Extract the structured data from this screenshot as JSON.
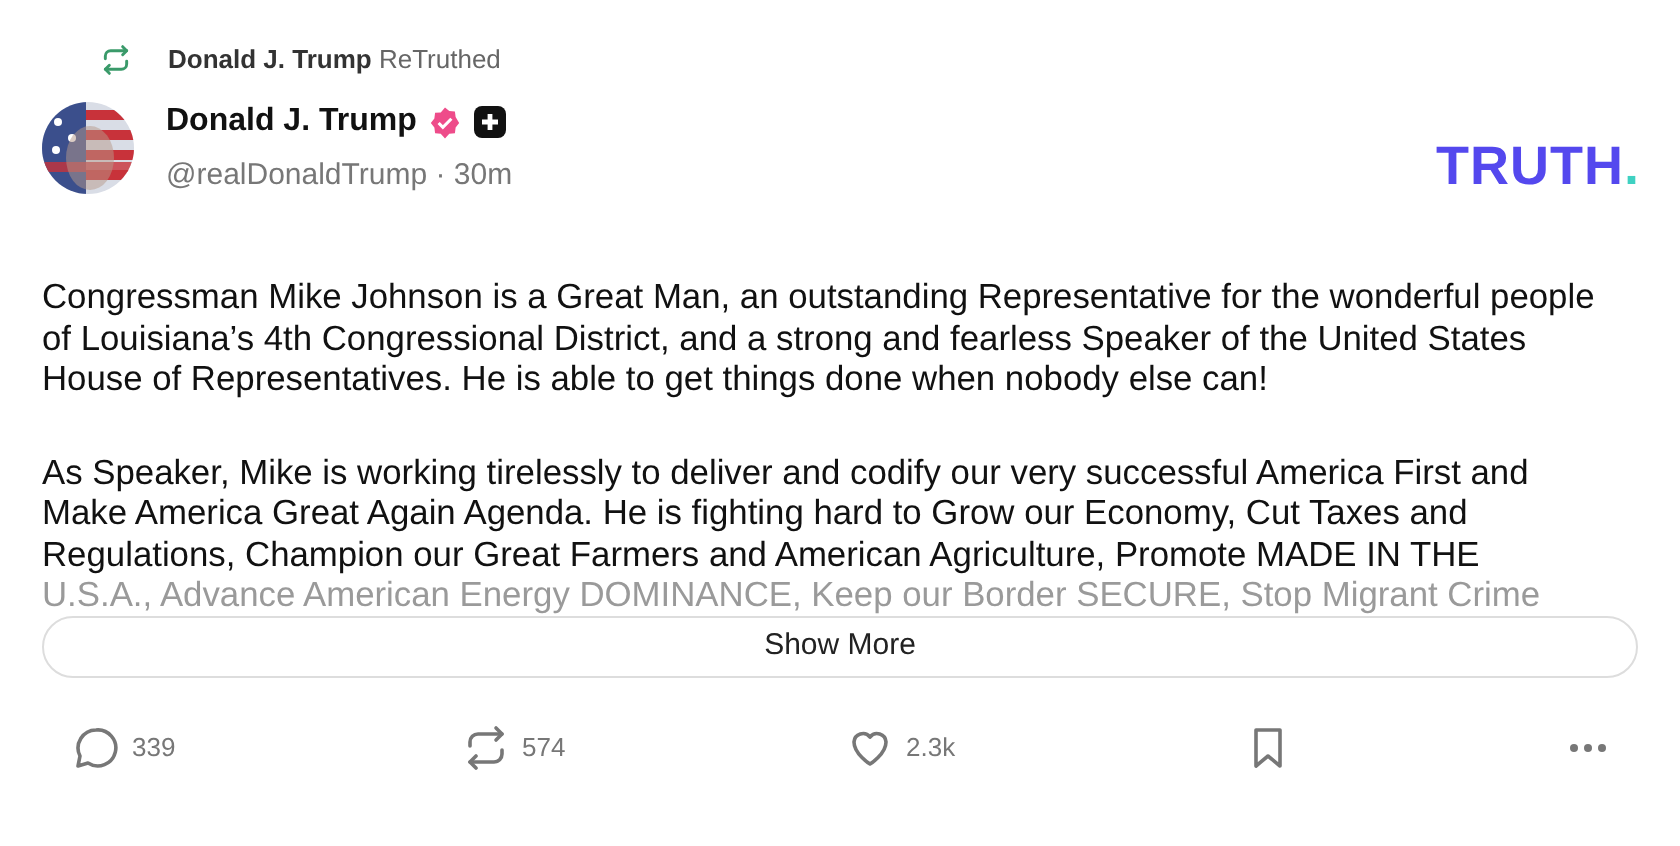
{
  "retruth": {
    "user": "Donald J. Trump",
    "label": "ReTruthed"
  },
  "author": {
    "name": "Donald J. Trump",
    "verified": true,
    "handle": "@realDonaldTrump",
    "separator": "·",
    "time": "30m"
  },
  "logo": {
    "text": "TRUTH",
    "mark": "."
  },
  "body": {
    "paragraphs": [
      "Congressman Mike Johnson is a Great Man, an outstanding Representative for the wonderful people of Louisiana’s 4th Congressional District, and a strong and fearless Speaker of the United States House of Representatives. He is able to get things done when nobody else can!",
      "As Speaker, Mike is working tirelessly to deliver and codify our very successful America First and Make America Great Again Agenda. He is fighting hard to Grow our Economy, Cut Taxes and Regulations, Champion our Great Farmers and American Agriculture, Promote MADE IN THE"
    ],
    "faded_line": "U.S.A., Advance American Energy DOMINANCE, Keep our Border SECURE, Stop Migrant Crime"
  },
  "show_more": "Show More",
  "actions": [
    {
      "kind": "reply",
      "count": "339"
    },
    {
      "kind": "repost",
      "count": "574"
    },
    {
      "kind": "like",
      "count": "2.3k"
    },
    {
      "kind": "bookmark"
    },
    {
      "kind": "more"
    }
  ]
}
